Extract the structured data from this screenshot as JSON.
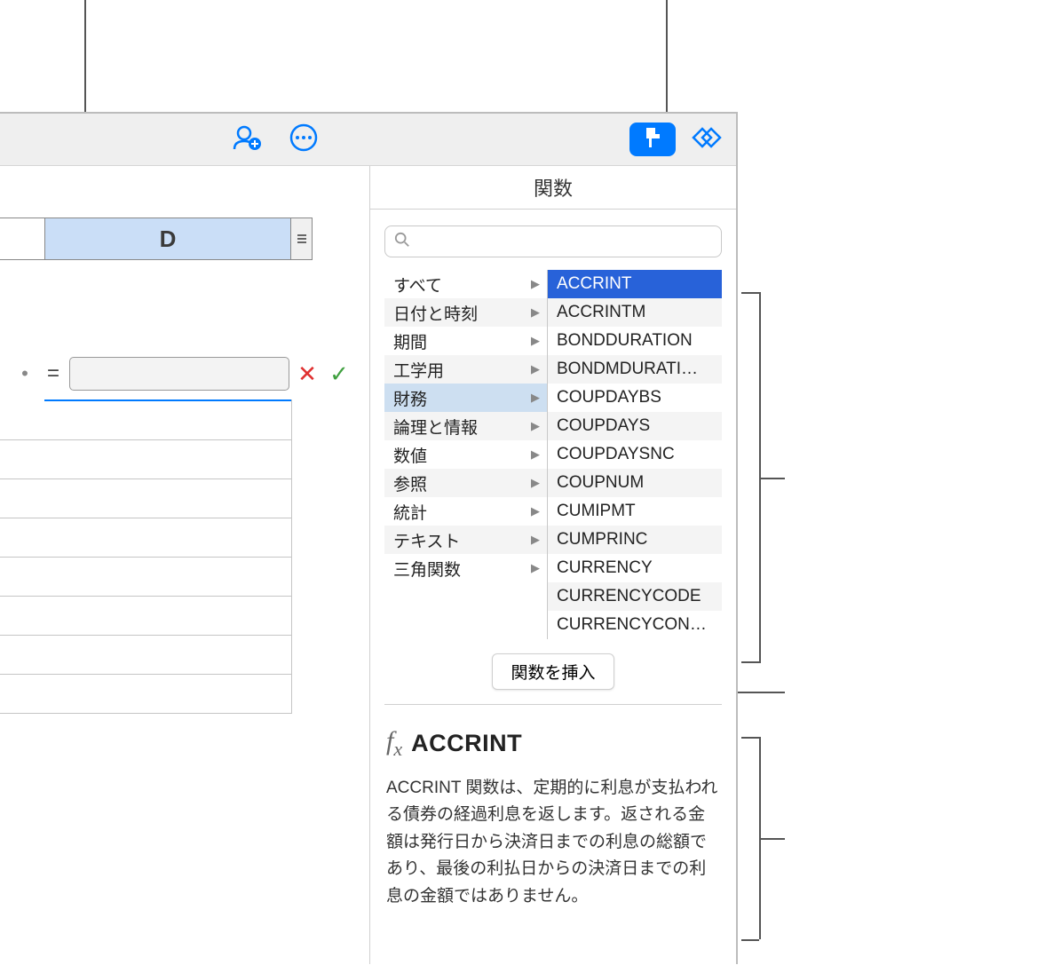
{
  "toolbar": {
    "collab_icon": "collaborator",
    "more_icon": "more",
    "format_icon": "format-brush",
    "shapes_icon": "shapes"
  },
  "spreadsheet": {
    "column_label": "D",
    "formula_eq": "=",
    "formula_value": ""
  },
  "sidebar": {
    "title": "関数",
    "search_placeholder": "",
    "categories": [
      "すべて",
      "日付と時刻",
      "期間",
      "工学用",
      "財務",
      "論理と情報",
      "数値",
      "参照",
      "統計",
      "テキスト",
      "三角関数"
    ],
    "selected_category_index": 4,
    "functions": [
      "ACCRINT",
      "ACCRINTM",
      "BONDDURATION",
      "BONDMDURATI…",
      "COUPDAYBS",
      "COUPDAYS",
      "COUPDAYSNC",
      "COUPNUM",
      "CUMIPMT",
      "CUMPRINC",
      "CURRENCY",
      "CURRENCYCODE",
      "CURRENCYCON…"
    ],
    "selected_function_index": 0,
    "insert_button": "関数を挿入",
    "detail": {
      "name": "ACCRINT",
      "description": "ACCRINT 関数は、定期的に利息が支払われる債券の経過利息を返します。返される金額は発行日から決済日までの利息の総額であり、最後の利払日からの決済日までの利息の金額ではありません。"
    }
  }
}
